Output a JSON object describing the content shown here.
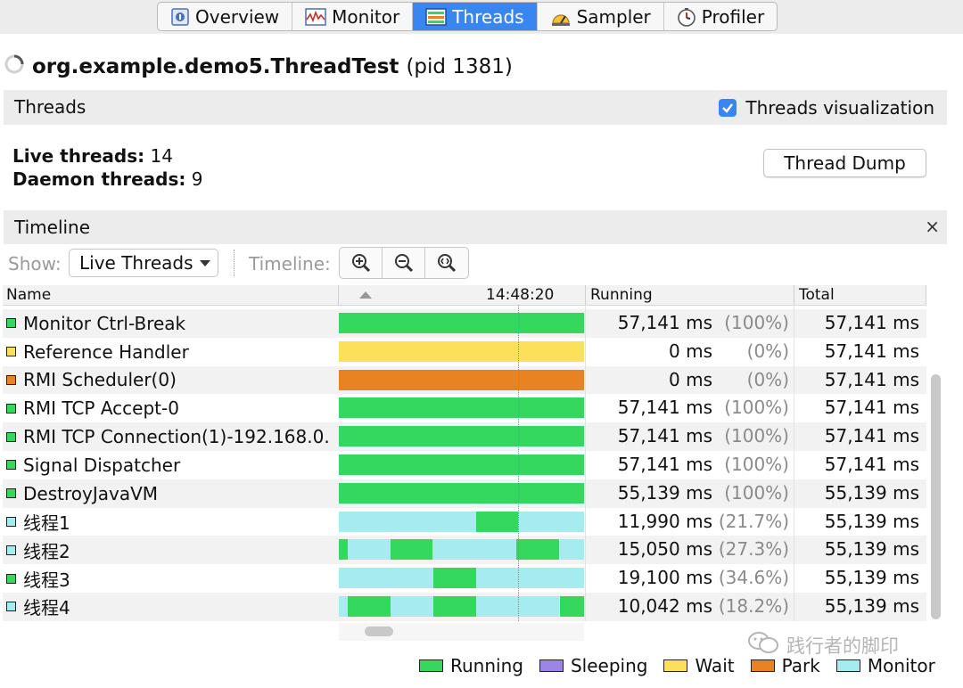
{
  "tabs": [
    {
      "label": "Overview",
      "icon": "overview-icon",
      "active": false
    },
    {
      "label": "Monitor",
      "icon": "monitor-icon",
      "active": false
    },
    {
      "label": "Threads",
      "icon": "threads-icon",
      "active": true
    },
    {
      "label": "Sampler",
      "icon": "sampler-icon",
      "active": false
    },
    {
      "label": "Profiler",
      "icon": "profiler-icon",
      "active": false
    }
  ],
  "app": {
    "name": "org.example.demo5.ThreadTest",
    "pid": "(pid 1381)"
  },
  "threads_section": {
    "label": "Threads",
    "visualization_label": "Threads visualization",
    "visualization_checked": true
  },
  "stats": {
    "live_label": "Live threads:",
    "live_value": "14",
    "daemon_label": "Daemon threads:",
    "daemon_value": "9"
  },
  "thread_dump_label": "Thread Dump",
  "timeline_section": {
    "label": "Timeline",
    "close": "×"
  },
  "toolbar": {
    "show_label": "Show:",
    "show_value": "Live Threads",
    "timeline_label": "Timeline:"
  },
  "columns": {
    "name": "Name",
    "time": "14:48:20",
    "running": "Running",
    "total": "Total"
  },
  "colors": {
    "running": "#34d85e",
    "sleeping": "#9d85e4",
    "wait": "#fde05a",
    "park": "#e98321",
    "monitor": "#a6ecef",
    "accent": "#3a86f0"
  },
  "rows": [
    {
      "name": "Monitor Ctrl-Break",
      "state": "running",
      "running": "57,141 ms",
      "pct": "(100%)",
      "total": "57,141 ms",
      "segments": [
        {
          "state": "running",
          "from": 0,
          "to": 1
        }
      ]
    },
    {
      "name": "Reference Handler",
      "state": "wait",
      "running": "0 ms",
      "pct": "(0%)",
      "total": "57,141 ms",
      "segments": [
        {
          "state": "wait",
          "from": 0,
          "to": 1
        }
      ]
    },
    {
      "name": "RMI Scheduler(0)",
      "state": "park",
      "running": "0 ms",
      "pct": "(0%)",
      "total": "57,141 ms",
      "segments": [
        {
          "state": "park",
          "from": 0,
          "to": 1
        }
      ]
    },
    {
      "name": "RMI TCP Accept-0",
      "state": "running",
      "running": "57,141 ms",
      "pct": "(100%)",
      "total": "57,141 ms",
      "segments": [
        {
          "state": "running",
          "from": 0,
          "to": 1
        }
      ]
    },
    {
      "name": "RMI TCP Connection(1)-192.168.0.",
      "state": "running",
      "running": "57,141 ms",
      "pct": "(100%)",
      "total": "57,141 ms",
      "segments": [
        {
          "state": "running",
          "from": 0,
          "to": 1
        }
      ]
    },
    {
      "name": "Signal Dispatcher",
      "state": "running",
      "running": "57,141 ms",
      "pct": "(100%)",
      "total": "57,141 ms",
      "segments": [
        {
          "state": "running",
          "from": 0,
          "to": 1
        }
      ]
    },
    {
      "name": "DestroyJavaVM",
      "state": "running",
      "running": "55,139 ms",
      "pct": "(100%)",
      "total": "55,139 ms",
      "segments": [
        {
          "state": "running",
          "from": 0,
          "to": 1
        }
      ]
    },
    {
      "name": "线程1",
      "state": "monitor",
      "running": "11,990 ms",
      "pct": "(21.7%)",
      "total": "55,139 ms",
      "segments": [
        {
          "state": "monitor",
          "from": 0,
          "to": 0.56
        },
        {
          "state": "running",
          "from": 0.56,
          "to": 0.73
        },
        {
          "state": "monitor",
          "from": 0.73,
          "to": 1
        }
      ]
    },
    {
      "name": "线程2",
      "state": "monitor",
      "running": "15,050 ms",
      "pct": "(27.3%)",
      "total": "55,139 ms",
      "segments": [
        {
          "state": "running",
          "from": 0,
          "to": 0.035
        },
        {
          "state": "monitor",
          "from": 0.035,
          "to": 0.21
        },
        {
          "state": "running",
          "from": 0.21,
          "to": 0.38
        },
        {
          "state": "monitor",
          "from": 0.38,
          "to": 0.725
        },
        {
          "state": "running",
          "from": 0.725,
          "to": 0.9
        },
        {
          "state": "monitor",
          "from": 0.9,
          "to": 1
        }
      ]
    },
    {
      "name": "线程3",
      "state": "running",
      "running": "19,100 ms",
      "pct": "(34.6%)",
      "total": "55,139 ms",
      "segments": [
        {
          "state": "monitor",
          "from": 0,
          "to": 0.385
        },
        {
          "state": "running",
          "from": 0.385,
          "to": 0.56
        },
        {
          "state": "monitor",
          "from": 0.56,
          "to": 1
        }
      ]
    },
    {
      "name": "线程4",
      "state": "monitor",
      "running": "10,042 ms",
      "pct": "(18.2%)",
      "total": "55,139 ms",
      "segments": [
        {
          "state": "monitor",
          "from": 0,
          "to": 0.035
        },
        {
          "state": "running",
          "from": 0.035,
          "to": 0.21
        },
        {
          "state": "monitor",
          "from": 0.21,
          "to": 0.385
        },
        {
          "state": "running",
          "from": 0.385,
          "to": 0.56
        },
        {
          "state": "monitor",
          "from": 0.56,
          "to": 0.9
        },
        {
          "state": "running",
          "from": 0.9,
          "to": 1
        }
      ]
    }
  ],
  "legend": [
    {
      "label": "Running",
      "state": "running"
    },
    {
      "label": "Sleeping",
      "state": "sleeping"
    },
    {
      "label": "Wait",
      "state": "wait"
    },
    {
      "label": "Park",
      "state": "park"
    },
    {
      "label": "Monitor",
      "state": "monitor"
    }
  ],
  "watermark": "践行者的脚印"
}
